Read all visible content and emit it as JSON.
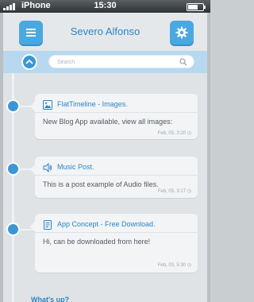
{
  "status_bar": {
    "carrier": "iPhone",
    "time": "15:30"
  },
  "header": {
    "title": "Severo Alfonso",
    "menu_icon": "hamburger-icon",
    "settings_icon": "gear-icon"
  },
  "search": {
    "placeholder": "Search",
    "up_icon": "chevron-up-icon",
    "search_icon": "search-icon"
  },
  "posts": [
    {
      "icon": "image-icon",
      "title": "FlatTimeline - Images.",
      "body": "New Blog App available, view all images:",
      "date": "Feb, 05,  3:20 ◷"
    },
    {
      "icon": "speaker-icon",
      "title": "Music Post.",
      "body": "This is a post example of Audio files.",
      "date": "Feb, 05,  3:17 ◷"
    },
    {
      "icon": "document-icon",
      "title": "App Concept - Free Download.",
      "body": "Hi, can be downloaded from here!",
      "date": "Feb, 03,  5:30 ◷"
    }
  ],
  "composer": {
    "prompt": "What's up?"
  },
  "colors": {
    "accent": "#3c96d4",
    "title_blue": "#2c85c4",
    "search_strip": "#b7d8ee",
    "card_bg": "#f2f4f6"
  }
}
